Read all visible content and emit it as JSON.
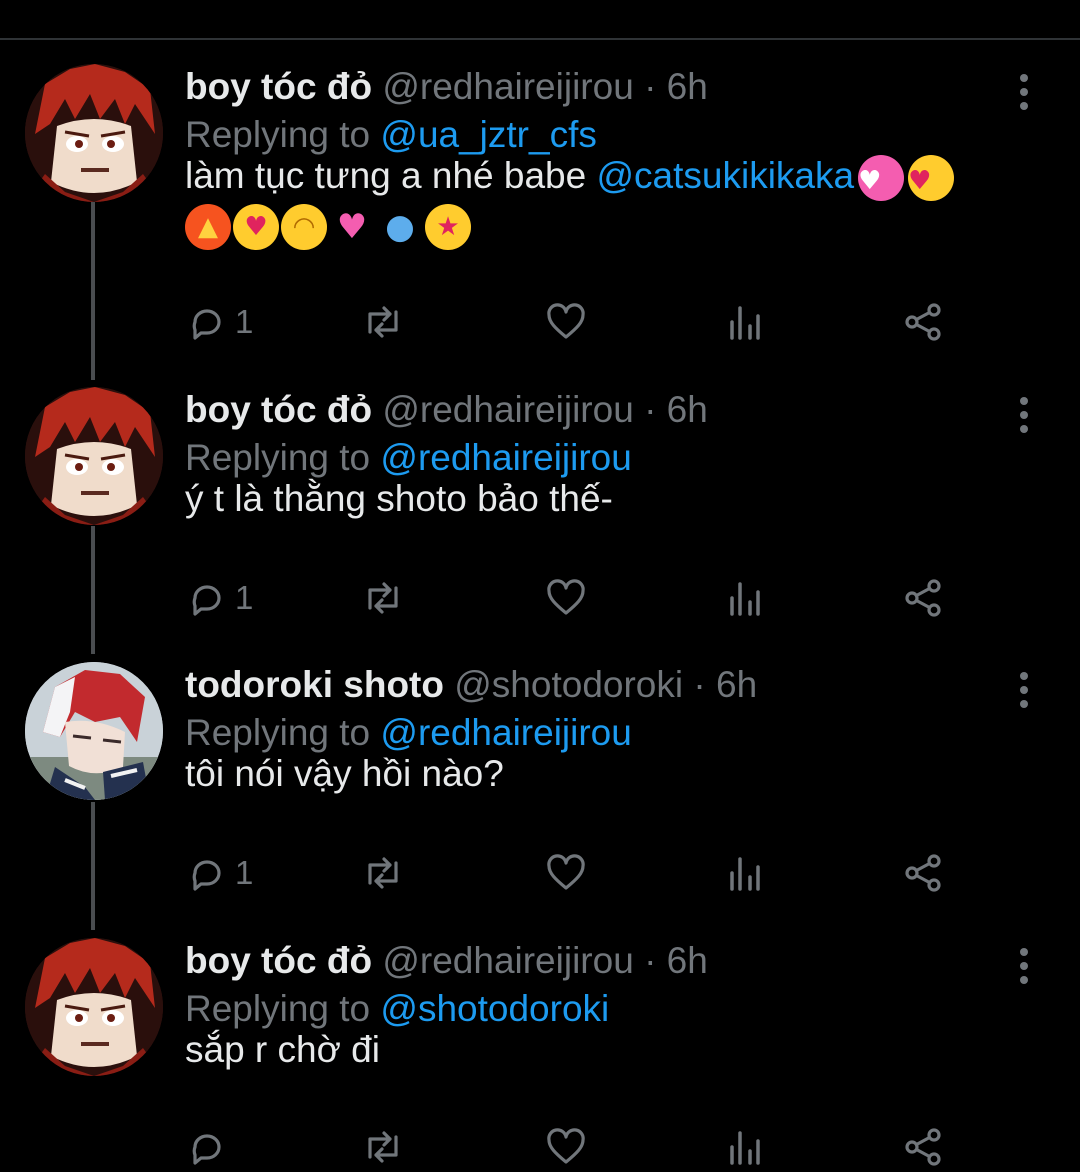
{
  "tweets": [
    {
      "name": "boy tóc đỏ",
      "handle": "@redhaireijirou",
      "time": "· 6h",
      "replying_prefix": "Replying to",
      "replying_to": "@ua_jztr_cfs",
      "text": "làm tục tưng a nhé babe",
      "text_mention": "@catsukikikaka",
      "emojis": [
        "sparkling-heart",
        "heart-eyes",
        "fire",
        "smiling-hearts",
        "hand-over-mouth",
        "two-hearts",
        "sweat-droplets",
        "star-struck"
      ],
      "reply_count": "1",
      "avatar": "red-hair-avatar"
    },
    {
      "name": "boy tóc đỏ",
      "handle": "@redhaireijirou",
      "time": "· 6h",
      "replying_prefix": "Replying to",
      "replying_to": "@redhaireijirou",
      "text": "ý t là thằng shoto bảo thế-",
      "reply_count": "1",
      "avatar": "red-hair-avatar"
    },
    {
      "name": "todoroki shoto",
      "handle": "@shotodoroki",
      "time": "· 6h",
      "replying_prefix": "Replying to",
      "replying_to": "@redhaireijirou",
      "text": "tôi nói vậy hồi nào?",
      "reply_count": "1",
      "avatar": "red-white-hair-avatar"
    },
    {
      "name": "boy tóc đỏ",
      "handle": "@redhaireijirou",
      "time": "· 6h",
      "replying_prefix": "Replying to",
      "replying_to": "@shotodoroki",
      "text": "sắp r chờ đi",
      "reply_count": "",
      "avatar": "red-hair-avatar"
    }
  ],
  "colors": {
    "background": "#000000",
    "text": "#e7e9ea",
    "secondary": "#71767b",
    "accent": "#1d9bf0",
    "thread_line": "#4a4d50"
  }
}
